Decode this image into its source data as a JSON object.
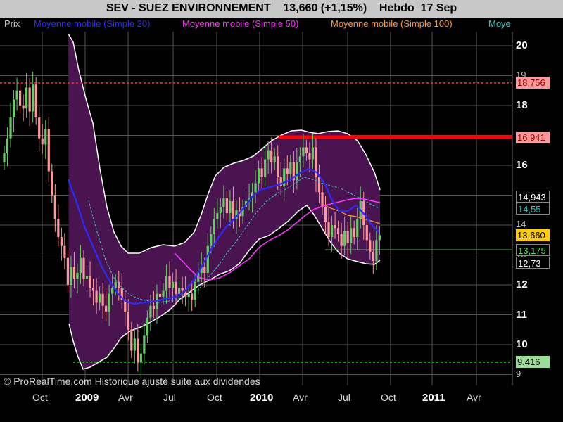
{
  "title": {
    "text": "SEV - SUEZ ENVIRONNEMENT    13,660 (+1,15%)    Hebdo  17 Sep"
  },
  "legend": [
    {
      "label": "Prix",
      "color": "#cccccc"
    },
    {
      "label": "Moyenne mobile (Simple 20)",
      "color": "#2b2bff"
    },
    {
      "label": "Moyenne mobile (Simple 50)",
      "color": "#ff33ff"
    },
    {
      "label": "Moyenne mobile (Simple 100)",
      "color": "#ff9933"
    },
    {
      "label": "Moye",
      "color": "#33cccc"
    }
  ],
  "copyright": "© ProRealTime.com Historique ajusté suite aux dividendes",
  "price_tags": [
    {
      "text": "18,756",
      "value": 18.756,
      "bg": "#ff9999",
      "fg": "#aa0000"
    },
    {
      "text": "16,941",
      "value": 16.941,
      "bg": "#ff9999",
      "fg": "#aa0000"
    },
    {
      "text": "14,943",
      "value": 14.943,
      "bg": "#000000",
      "fg": "#ffffff"
    },
    {
      "text": "14,55",
      "value": 14.55,
      "bg": "#000000",
      "fg": "#33cccc"
    },
    {
      "text": "13,660",
      "value": 13.66,
      "bg": "#ffcc00",
      "fg": "#000000"
    },
    {
      "text": "13,175",
      "value": 13.175,
      "bg": "#000000",
      "fg": "#66dd66"
    },
    {
      "text": "12,73",
      "value": 12.73,
      "bg": "#000000",
      "fg": "#ffffff"
    },
    {
      "text": "9,416",
      "value": 9.416,
      "bg": "#99dd99",
      "fg": "#000000"
    }
  ],
  "colors": {
    "up": "#66cc66",
    "down": "#ff9999",
    "band_fill": "#4a1450",
    "band_line": "#ffffff",
    "resistance": "#ff0000",
    "dotted_high": "#ff3333",
    "dotted_low": "#33cc33",
    "support": "#66dd66",
    "grid": "#555555"
  },
  "chart_data": {
    "type": "candlestick",
    "title": "SEV - SUEZ ENVIRONNEMENT 13,660 (+1,15%) Hebdo 17 Sep",
    "x_labels": [
      "Oct",
      "2009",
      "Avr",
      "Jul",
      "Oct",
      "2010",
      "Avr",
      "Jul",
      "Oct",
      "2011",
      "Avr"
    ],
    "y_ticks": [
      9,
      10,
      11,
      12,
      13,
      14,
      15,
      16,
      17,
      18,
      19,
      20
    ],
    "ylim": [
      8.9,
      20.8
    ],
    "grid": true,
    "legend_position": "top",
    "closes": [
      16.4,
      16.9,
      17.6,
      18.2,
      18.5,
      18.0,
      17.9,
      18.6,
      17.8,
      18.7,
      17.6,
      16.9,
      16.7,
      17.2,
      15.8,
      15.0,
      14.2,
      13.6,
      13.3,
      12.9,
      12.0,
      12.6,
      12.2,
      12.4,
      12.9,
      12.2,
      12.3,
      11.9,
      11.8,
      11.4,
      11.7,
      11.3,
      11.1,
      11.7,
      11.9,
      12.1,
      11.9,
      11.5,
      11.1,
      10.5,
      9.8,
      10.2,
      9.4,
      9.7,
      10.3,
      10.9,
      11.3,
      11.2,
      11.7,
      11.6,
      11.8,
      12.3,
      11.9,
      12.1,
      11.7,
      11.9,
      11.8,
      11.6,
      11.7,
      11.5,
      12.1,
      12.4,
      12.6,
      12.4,
      13.3,
      13.7,
      14.2,
      14.4,
      14.6,
      14.9,
      14.4,
      14.8,
      14.2,
      14.5,
      14.3,
      14.6,
      14.8,
      14.9,
      15.1,
      15.4,
      15.9,
      15.6,
      16.2,
      16.5,
      16.1,
      16.3,
      15.6,
      15.3,
      15.9,
      15.7,
      16.1,
      15.5,
      16.1,
      16.3,
      16.6,
      16.4,
      16.2,
      16.6,
      15.6,
      15.1,
      14.6,
      14.1,
      13.6,
      14.0,
      13.9,
      13.7,
      13.3,
      13.8,
      13.4,
      13.9,
      13.6,
      14.2,
      14.8,
      14.0,
      13.5,
      13.1,
      12.8,
      13.5,
      13.66
    ],
    "series": [
      {
        "name": "Moyenne mobile (Simple 20)"
      },
      {
        "name": "Moyenne mobile (Simple 50)"
      },
      {
        "name": "Moyenne mobile (Simple 100)"
      },
      {
        "name": "Moye"
      }
    ],
    "horizontal_lines": [
      {
        "value": 18.756,
        "style": "dotted",
        "color": "#ff3333"
      },
      {
        "value": 16.941,
        "style": "solid",
        "color": "#ff0000"
      },
      {
        "value": 13.175,
        "style": "solid",
        "color": "#66dd66"
      },
      {
        "value": 9.416,
        "style": "dotted",
        "color": "#33cc33"
      }
    ]
  }
}
